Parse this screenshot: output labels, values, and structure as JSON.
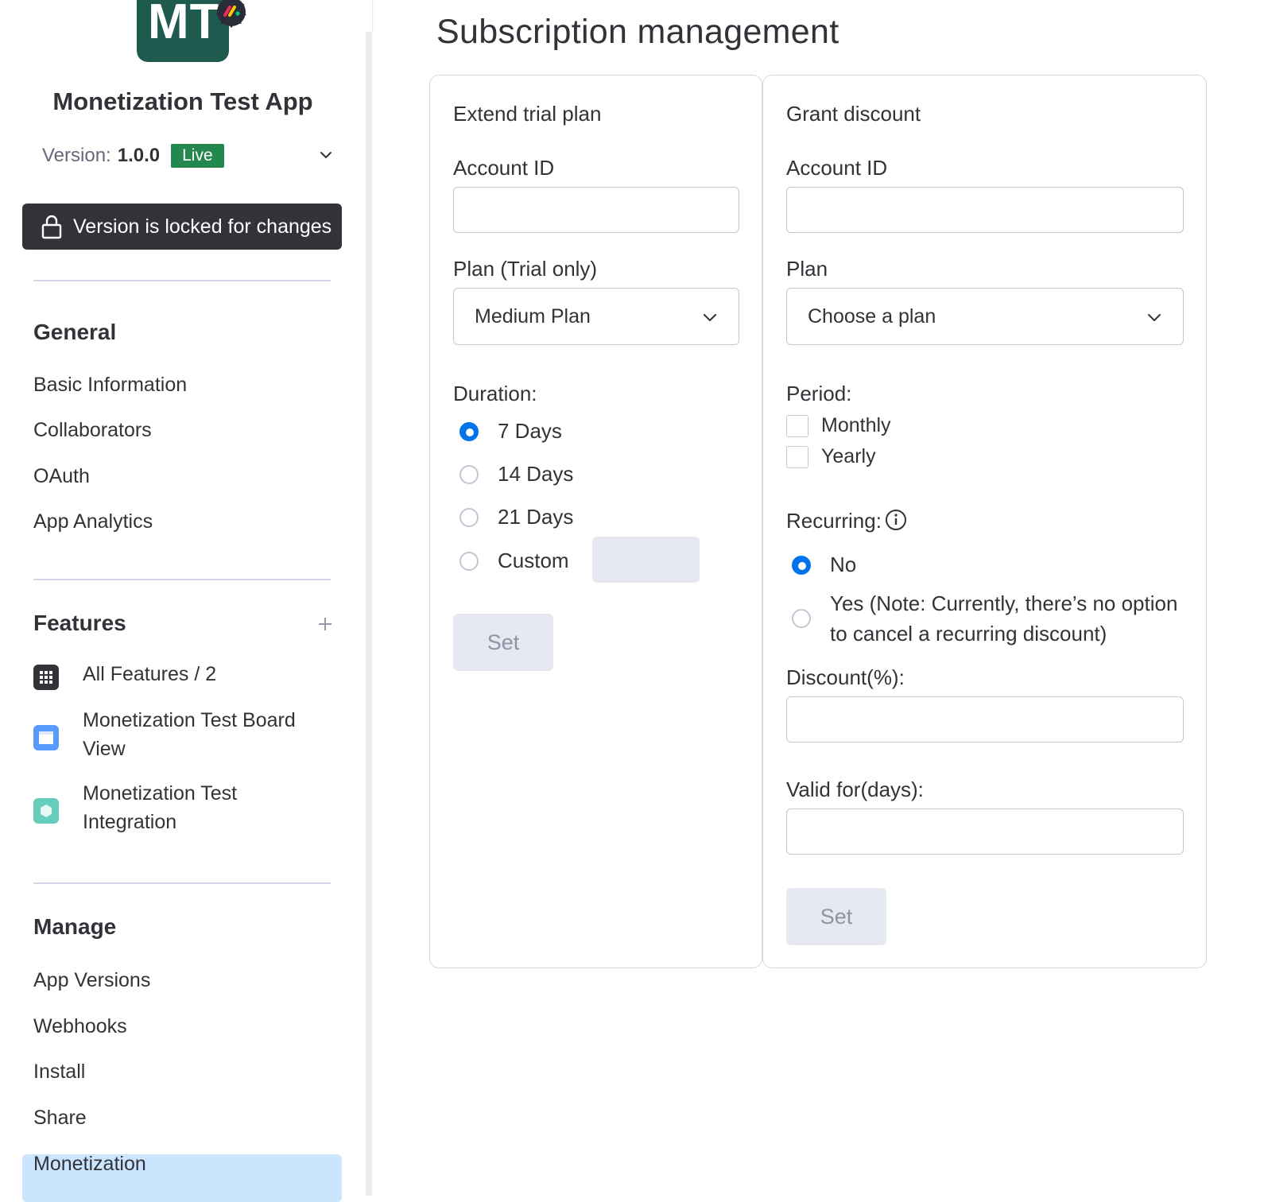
{
  "sidebar": {
    "logo_text": "MT",
    "app_name": "Monetization Test App",
    "version_label": "Version:",
    "version_number": "1.0.0",
    "version_status": "Live",
    "locked_text": "Version is locked for changes",
    "general": {
      "title": "General",
      "items": [
        "Basic Information",
        "Collaborators",
        "OAuth",
        "App Analytics"
      ]
    },
    "features": {
      "title": "Features",
      "items": [
        {
          "label": "All Features / 2",
          "icon": "grid-icon"
        },
        {
          "label": "Monetization Test Board View",
          "icon": "board-view-icon"
        },
        {
          "label": "Monetization Test Integration",
          "icon": "integration-icon"
        }
      ]
    },
    "manage": {
      "title": "Manage",
      "items": [
        "App Versions",
        "Webhooks",
        "Install",
        "Share",
        "Monetization"
      ],
      "active": "Monetization"
    }
  },
  "main": {
    "title": "Subscription management",
    "extend_trial": {
      "title": "Extend trial plan",
      "account_id_label": "Account ID",
      "account_id_value": "",
      "plan_label": "Plan (Trial only)",
      "plan_value": "Medium Plan",
      "duration_label": "Duration:",
      "duration_options": [
        "7 Days",
        "14 Days",
        "21 Days",
        "Custom"
      ],
      "duration_selected": "7 Days",
      "custom_value": "",
      "set_label": "Set"
    },
    "grant_discount": {
      "title": "Grant discount",
      "account_id_label": "Account ID",
      "account_id_value": "",
      "plan_label": "Plan",
      "plan_placeholder": "Choose a plan",
      "period_label": "Period:",
      "period_options": [
        "Monthly",
        "Yearly"
      ],
      "recurring_label": "Recurring:",
      "recurring_options": [
        "No",
        "Yes (Note: Currently, there’s no option to cancel a recurring discount)"
      ],
      "recurring_selected": "No",
      "discount_label": "Discount(%):",
      "discount_value": "",
      "valid_for_label": "Valid for(days):",
      "valid_for_value": "",
      "set_label": "Set"
    }
  },
  "colors": {
    "accent": "#0073ea",
    "live_badge": "#258750",
    "locked_bar": "#323338",
    "active_nav": "#cce5ff",
    "logo_bg": "#1e5a4e"
  }
}
